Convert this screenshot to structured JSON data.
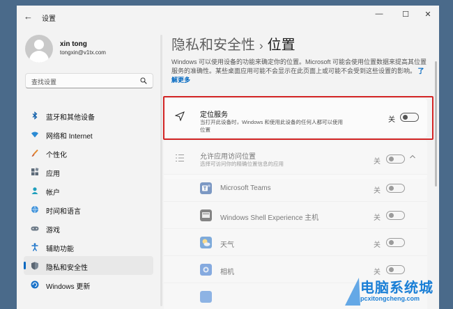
{
  "window": {
    "back_glyph": "←",
    "title": "设置",
    "minimize": "—",
    "maximize": "☐",
    "close": "✕"
  },
  "profile": {
    "name": "xin tong",
    "email": "tongxin@v1tx.com"
  },
  "search": {
    "placeholder": "查找设置"
  },
  "sidebar": {
    "items": [
      {
        "label": "蓝牙和其他设备",
        "icon": "bluetooth-icon"
      },
      {
        "label": "网络和 Internet",
        "icon": "wifi-icon"
      },
      {
        "label": "个性化",
        "icon": "brush-icon"
      },
      {
        "label": "应用",
        "icon": "apps-icon"
      },
      {
        "label": "帐户",
        "icon": "person-icon"
      },
      {
        "label": "时间和语言",
        "icon": "globe-clock-icon"
      },
      {
        "label": "游戏",
        "icon": "gamepad-icon"
      },
      {
        "label": "辅助功能",
        "icon": "accessibility-icon"
      },
      {
        "label": "隐私和安全性",
        "icon": "shield-icon",
        "active": true
      },
      {
        "label": "Windows 更新",
        "icon": "update-icon"
      }
    ]
  },
  "main": {
    "breadcrumb_parent": "隐私和安全性",
    "breadcrumb_sep": "›",
    "breadcrumb_current": "位置",
    "intro": "Windows 可以使用设备的功能来确定你的位置。Microsoft 可能会使用位置数据来提高其位置服务的准确性。某些桌面应用可能不会显示在此页面上或可能不会受到这些设置的影响。",
    "learn_more": "了解更多",
    "location_service": {
      "title": "定位服务",
      "subtitle": "当打开此设备时，Windows 和使用此设备的任何人都可以使用位置",
      "state_label": "关",
      "on": false
    },
    "app_access": {
      "title": "允许应用访问位置",
      "subtitle": "选择可访问你的精确位置信息的应用",
      "state_label": "关",
      "on": false
    },
    "apps": [
      {
        "label": "Microsoft Teams",
        "state_label": "关",
        "icon": "teams-icon"
      },
      {
        "label": "Windows Shell Experience 主机",
        "state_label": "关",
        "icon": "shell-icon"
      },
      {
        "label": "天气",
        "state_label": "关",
        "icon": "weather-icon"
      },
      {
        "label": "相机",
        "state_label": "关",
        "icon": "camera-icon"
      }
    ]
  },
  "watermark": {
    "title": "电脑系统城",
    "url": "pcxitongcheng.com"
  },
  "colors": {
    "accent": "#0067c0",
    "highlight_border": "#d22424",
    "watermark": "#1a7fd6"
  }
}
